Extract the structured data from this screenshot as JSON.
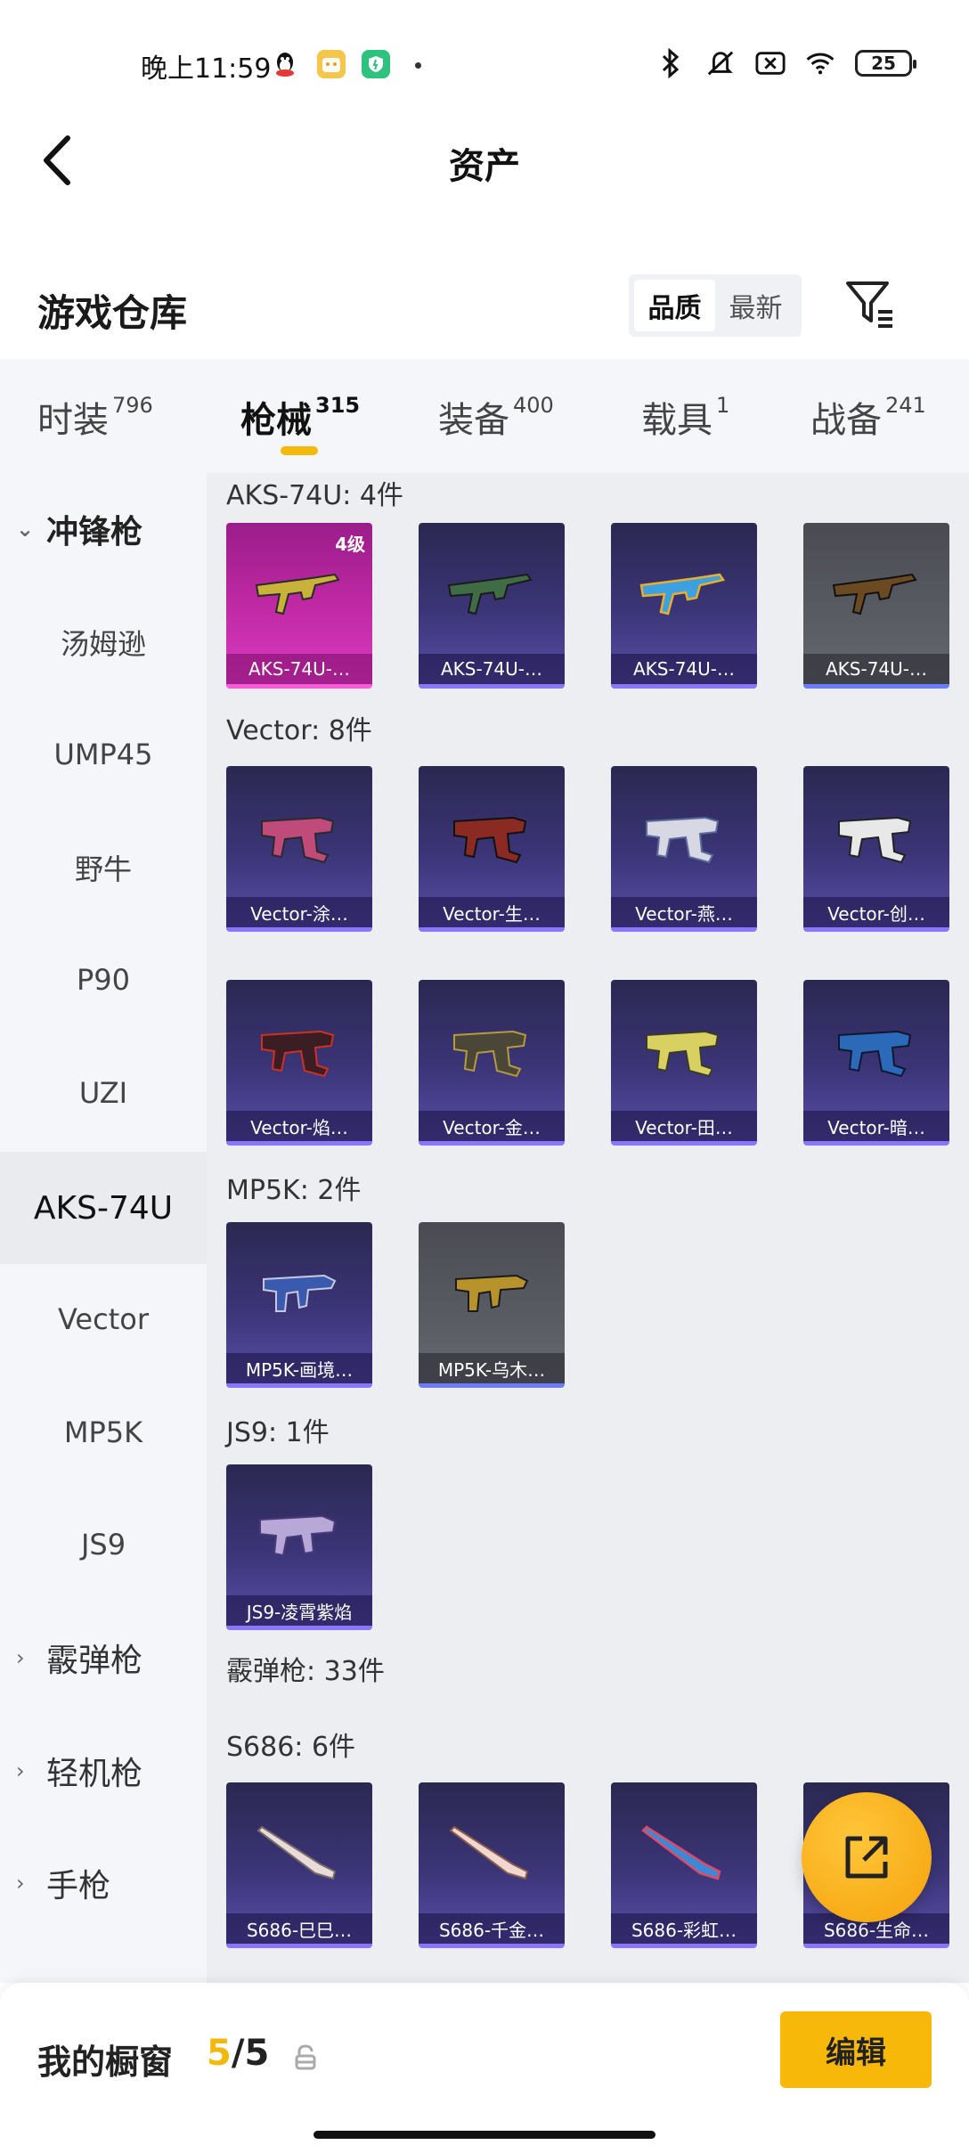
{
  "status_bar": {
    "time": "晚上11:59",
    "battery": "25"
  },
  "nav": {
    "title": "资产"
  },
  "warehouse": {
    "title": "游戏仓库",
    "sort_options": [
      "品质",
      "最新"
    ],
    "active_sort": "品质"
  },
  "tabs": [
    {
      "label": "时装",
      "count": "796"
    },
    {
      "label": "枪械",
      "count": "315"
    },
    {
      "label": "装备",
      "count": "400"
    },
    {
      "label": "载具",
      "count": "1"
    },
    {
      "label": "战备",
      "count": "241"
    }
  ],
  "sidebar": {
    "group_smg": "冲锋枪",
    "items": [
      "汤姆逊",
      "UMP45",
      "野牛",
      "P90",
      "UZI",
      "AKS-74U",
      "Vector",
      "MP5K",
      "JS9"
    ],
    "group_shotgun": "霰弹枪",
    "group_lmg": "轻机枪",
    "group_pistol": "手枪"
  },
  "content": {
    "aks_title": "AKS-74U: 4件",
    "aks_cards": [
      {
        "label": "AKS-74U-…",
        "badge": "4级"
      },
      {
        "label": "AKS-74U-…"
      },
      {
        "label": "AKS-74U-…"
      },
      {
        "label": "AKS-74U-…"
      }
    ],
    "vector_title": "Vector: 8件",
    "vector_cards": [
      {
        "label": "Vector-涂…"
      },
      {
        "label": "Vector-生…"
      },
      {
        "label": "Vector-燕…"
      },
      {
        "label": "Vector-创…"
      },
      {
        "label": "Vector-焰…"
      },
      {
        "label": "Vector-金…"
      },
      {
        "label": "Vector-田…"
      },
      {
        "label": "Vector-暗…"
      }
    ],
    "mp5k_title": "MP5K: 2件",
    "mp5k_cards": [
      {
        "label": "MP5K-画境…"
      },
      {
        "label": "MP5K-乌木…"
      }
    ],
    "js9_title": "JS9: 1件",
    "js9_cards": [
      {
        "label": "JS9-凌霄紫焰"
      }
    ],
    "shotgun_title": "霰弹枪: 33件",
    "s686_title": "S686: 6件",
    "s686_cards": [
      {
        "label": "S686-巳巳…"
      },
      {
        "label": "S686-千金…"
      },
      {
        "label": "S686-彩虹…"
      },
      {
        "label": "S686-生命…"
      }
    ]
  },
  "bottom": {
    "showcase_label": "我的橱窗",
    "showcase_current": "5",
    "showcase_total": "/5",
    "edit_label": "编辑"
  },
  "colors": {
    "accent": "#f5b90c",
    "card_purple": "#3b3578",
    "card_pink": "#c22aa6",
    "card_gray": "#5a5c64"
  }
}
